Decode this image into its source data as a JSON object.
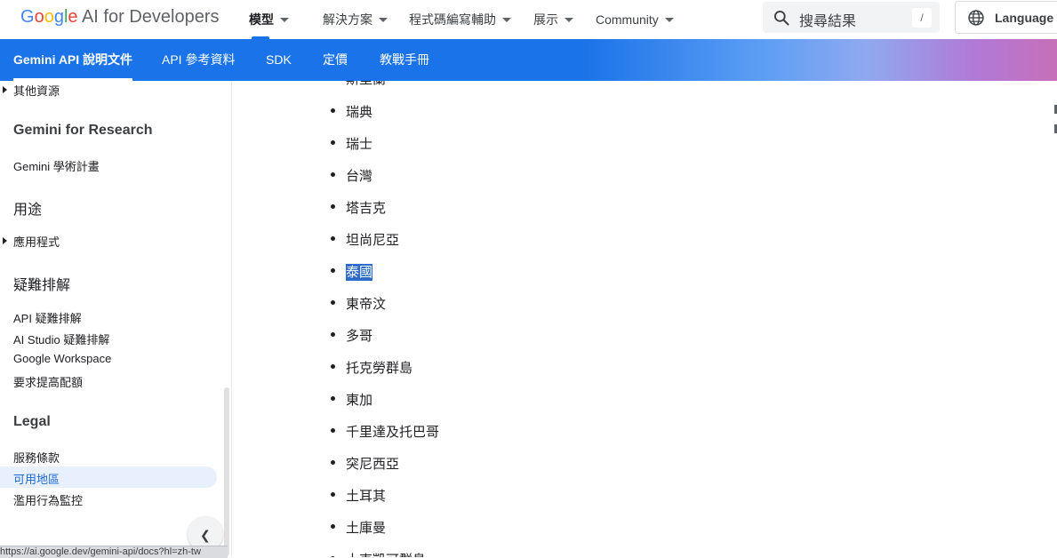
{
  "header": {
    "logo": {
      "google": "Google",
      "rest": "AI for Developers"
    },
    "nav": [
      {
        "label": "模型",
        "active": true
      },
      {
        "label": "解決方案"
      },
      {
        "label": "程式碼編寫輔助"
      },
      {
        "label": "展示"
      },
      {
        "label": "Community"
      }
    ],
    "search_placeholder": "搜尋結果",
    "search_shortcut": "/",
    "language_label": "Language"
  },
  "tabs": [
    {
      "label": "Gemini API 說明文件",
      "active": true
    },
    {
      "label": "API 參考資料"
    },
    {
      "label": "SDK"
    },
    {
      "label": "定價"
    },
    {
      "label": "教戰手冊"
    }
  ],
  "sidebar": {
    "top_item": "其他資源",
    "sections": [
      {
        "title": "Gemini for Research",
        "items": [
          "Gemini 學術計畫"
        ]
      },
      {
        "title": "用途",
        "items": [
          "應用程式"
        ]
      },
      {
        "title": "疑難排解",
        "items": [
          "API 疑難排解",
          "AI Studio 疑難排解",
          "Google Workspace",
          "要求提高配額"
        ]
      },
      {
        "title": "Legal",
        "items": [
          "服務條款",
          "可用地區",
          "濫用行為監控"
        ]
      }
    ],
    "selected_item": "可用地區",
    "status_url": "https://ai.google.dev/gemini-api/docs?hl=zh-tw"
  },
  "countries": {
    "partial_top": "斯里蘭",
    "items": [
      "瑞典",
      "瑞士",
      "台灣",
      "塔吉克",
      "坦尚尼亞",
      "泰國",
      "東帝汶",
      "多哥",
      "托克勞群島",
      "東加",
      "千里達及托巴哥",
      "突尼西亞",
      "土耳其",
      "土庫曼",
      "土克凱可群島"
    ],
    "highlighted": "泰國"
  },
  "colors": {
    "brand_blue": "#1a73e8",
    "selection": "#2c6bc8",
    "active_bg": "#e8f0fe"
  }
}
